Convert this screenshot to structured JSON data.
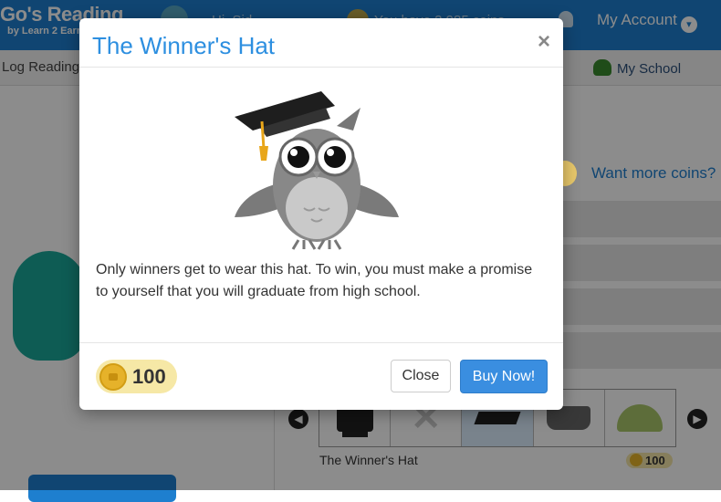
{
  "header": {
    "brand_title": "Go's Reading",
    "brand_sub": "by Learn 2 Earn",
    "greeting": "Hi, Sid",
    "coins_text": "You have 2,985 coins",
    "account_label": "My Account"
  },
  "nav": {
    "log_reading": "Log Reading",
    "my_school": "My School"
  },
  "side": {
    "want_more_coins": "Want more coins?"
  },
  "store": {
    "selected_name": "The Winner's Hat",
    "selected_price": "100"
  },
  "modal": {
    "title": "The Winner's Hat",
    "close_symbol": "×",
    "description": "Only winners get to wear this hat. To win, you must make a promise to yourself that you will graduate from high school.",
    "price": "100",
    "close_button": "Close",
    "buy_button": "Buy Now!"
  },
  "colors": {
    "brand_blue": "#1e7fcf",
    "title_blue": "#2d8fe0",
    "buy_blue": "#3a8ee0",
    "coin_gold": "#e6b22a",
    "price_bg": "#f6e8a6"
  }
}
